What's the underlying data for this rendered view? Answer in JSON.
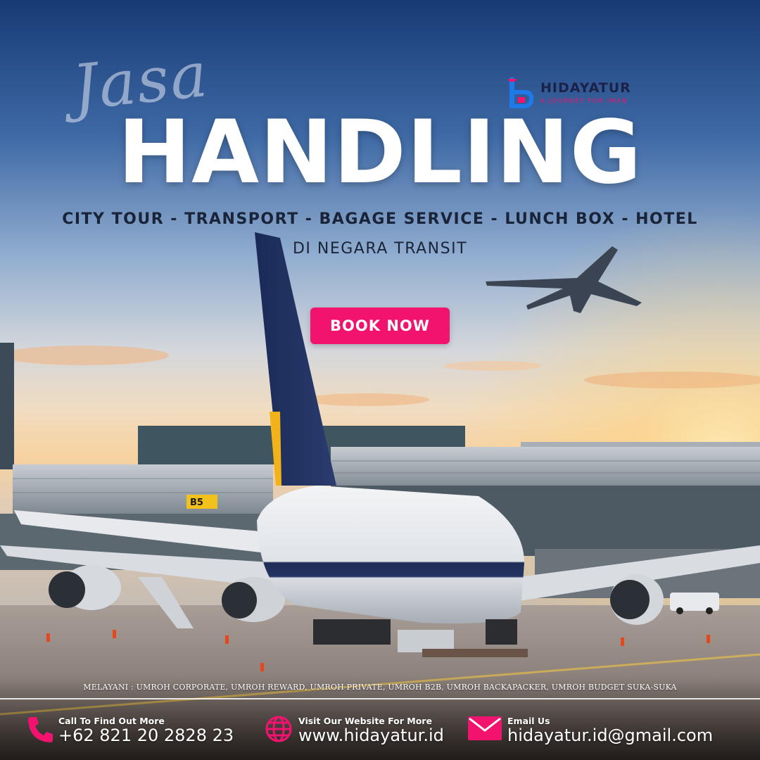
{
  "headline": {
    "script_word": "Jasa",
    "main_word": "HANDLING"
  },
  "services_line": "CITY TOUR - TRANSPORT - BAGAGE SERVICE - LUNCH BOX - HOTEL",
  "subtitle": "DI NEGARA TRANSIT",
  "cta": {
    "label": "BOOK NOW"
  },
  "brand": {
    "name": "HIDAYATUR",
    "tagline": "A JOURNEY FOR IMAN",
    "logo_icon": "hidayatur-logo-icon"
  },
  "gate_sign": "B5",
  "serve_line": "MELAYANI : UMROH CORPORATE, UMROH REWARD, UMROH PRIVATE, UMROH B2B, UMROH BACKAPACKER, UMROH BUDGET SUKA-SUKA",
  "footer": {
    "phone": {
      "label": "Call To Find Out More",
      "value": "+62 821 20 2828 23",
      "icon": "phone-icon"
    },
    "website": {
      "label": "Visit Our Website For More",
      "value": "www.hidayatur.id",
      "icon": "globe-icon"
    },
    "email": {
      "label": "Email Us",
      "value": "hidayatur.id@gmail.com",
      "icon": "mail-icon"
    }
  },
  "colors": {
    "accent": "#f2136f",
    "brand_dark": "#1b2147",
    "headline": "#ffffff",
    "services_text": "#1a2438"
  }
}
